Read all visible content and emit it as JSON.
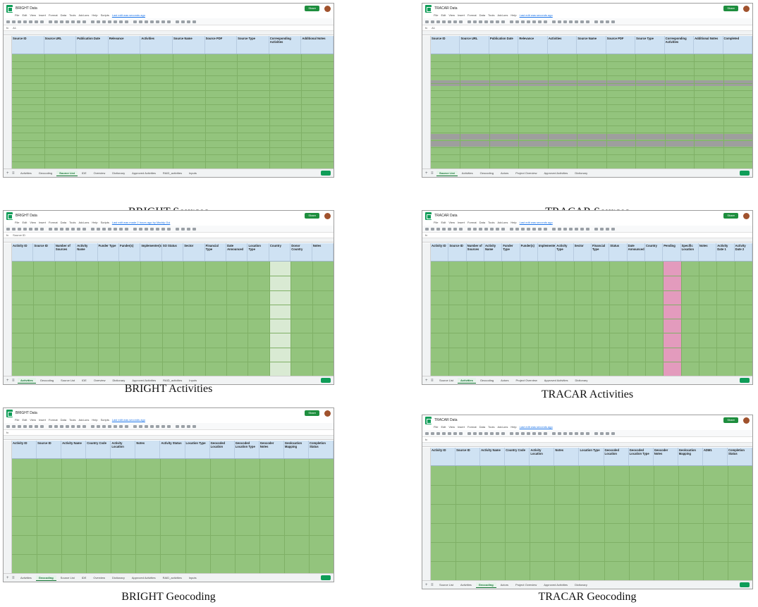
{
  "panels": [
    {
      "caption": "BRIGHT Sources",
      "doc_title": "BRIGHT Data",
      "menus": [
        "File",
        "Edit",
        "View",
        "Insert",
        "Format",
        "Data",
        "Tools",
        "Add-ons",
        "Help",
        "Scripts"
      ],
      "last_edit": "Last edit was seconds ago",
      "cell_ref": "A1",
      "headers": [
        "Source ID",
        "Source URL",
        "Publication Date",
        "Relevance",
        "Activities",
        "Source Name",
        "Source PDF",
        "Source Type",
        "Corresponding Activities",
        "Additional Notes"
      ],
      "tabs": [
        "Activities",
        "Geocoding",
        "Source List",
        "IDE",
        "Overview",
        "Dictionary",
        "Approved Activities",
        "RAID_activities",
        "Inputs"
      ],
      "active_tab": "Source List"
    },
    {
      "caption": "TRACAR Sources",
      "doc_title": "TRACAR Data",
      "menus": [
        "File",
        "Edit",
        "View",
        "Insert",
        "Format",
        "Data",
        "Tools",
        "Add-ons",
        "Help"
      ],
      "last_edit": "Last edit was seconds ago",
      "cell_ref": "A1",
      "headers": [
        "Source ID",
        "Source URL",
        "Publication Date",
        "Relevance",
        "Activities",
        "Source Name",
        "Source PDF",
        "Source Type",
        "Corresponding Activities",
        "Additional Notes",
        "Completed"
      ],
      "tabs": [
        "Source List",
        "Activities",
        "Geocoding",
        "Actors",
        "Project Overview",
        "Approved Activities",
        "Dictionary"
      ],
      "active_tab": "Source List"
    },
    {
      "caption": "BRIGHT Activities",
      "doc_title": "BRIGHT Data",
      "menus": [
        "File",
        "Edit",
        "View",
        "Insert",
        "Format",
        "Data",
        "Tools",
        "Add-ons",
        "Help",
        "Scripts"
      ],
      "last_edit": "Last edit was made 2 hours ago by Maddy Gui",
      "cell_ref": "Source ID",
      "headers": [
        "Activity ID",
        "Source ID",
        "Number of Sources",
        "Activity Name",
        "Funder Type",
        "Funder(s)",
        "Implementer(s)",
        "SO Status",
        "Sector",
        "Financial Type",
        "Date Announced",
        "Location Type",
        "Country",
        "Donor Country",
        "Notes"
      ],
      "tabs": [
        "Activities",
        "Geocoding",
        "Source List",
        "IDE",
        "Overview",
        "Dictionary",
        "Approved Activities",
        "RAID_activities",
        "Inputs"
      ],
      "active_tab": "Activities"
    },
    {
      "caption": "TRACAR Activities",
      "doc_title": "TRACAR Data",
      "menus": [
        "File",
        "Edit",
        "View",
        "Insert",
        "Format",
        "Data",
        "Tools",
        "Add-ons",
        "Help"
      ],
      "last_edit": "Last edit was seconds ago",
      "cell_ref": "",
      "headers": [
        "Activity ID",
        "Source ID",
        "Number of Sources",
        "Activity Name",
        "Funder Type",
        "Funder(s)",
        "Implementer(s)",
        "Activity Type",
        "Sector",
        "Financial Type",
        "Status",
        "Date Announced",
        "Country",
        "Pending",
        "Specific Location",
        "Notes",
        "Activity Date 1",
        "Activity Date 2"
      ],
      "tabs": [
        "Source List",
        "Activities",
        "Geocoding",
        "Actors",
        "Project Overview",
        "Approved Activities",
        "Dictionary"
      ],
      "active_tab": "Activities"
    },
    {
      "caption": "BRIGHT Geocoding",
      "doc_title": "BRIGHT Data",
      "menus": [
        "File",
        "Edit",
        "View",
        "Insert",
        "Format",
        "Data",
        "Tools",
        "Add-ons",
        "Help",
        "Scripts"
      ],
      "last_edit": "Last edit was seconds ago",
      "cell_ref": "",
      "headers": [
        "Activity ID",
        "Source ID",
        "Activity Name",
        "Country Code",
        "Activity Location",
        "Notes",
        "Activity Status",
        "Location Type",
        "Geocoded Location",
        "Geocoded Location Type",
        "Geocoder Notes",
        "Geolocation Mapping",
        "Completion Status"
      ],
      "tabs": [
        "Activities",
        "Geocoding",
        "Source List",
        "IDE",
        "Overview",
        "Dictionary",
        "Approved Activities",
        "RAID_activities",
        "Inputs"
      ],
      "active_tab": "Geocoding"
    },
    {
      "caption": "TRACAR Geocoding",
      "doc_title": "TRACAR Data",
      "menus": [
        "File",
        "Edit",
        "View",
        "Insert",
        "Format",
        "Data",
        "Tools",
        "Add-ons",
        "Help"
      ],
      "last_edit": "Last edit was seconds ago",
      "cell_ref": "",
      "headers": [
        "Activity ID",
        "Source ID",
        "Activity Name",
        "Country Code",
        "Activity Location",
        "Notes",
        "Location Type",
        "Geocoded Location",
        "Geocoded Location Type",
        "Geocoder Notes",
        "Geolocation Mapping",
        "ADM1",
        "Completion Status"
      ],
      "tabs": [
        "Source List",
        "Activities",
        "Geocoding",
        "Actors",
        "Project Overview",
        "Approved Activities",
        "Dictionary"
      ],
      "active_tab": "Geocoding"
    }
  ],
  "share_label": "Share",
  "colors": {
    "header_blue": "#cfe2f3",
    "row_green": "#93c47d",
    "gray_row": "#9e9e9e",
    "pink_col": "#e39bbd",
    "sheets_green": "#0f9d58"
  }
}
